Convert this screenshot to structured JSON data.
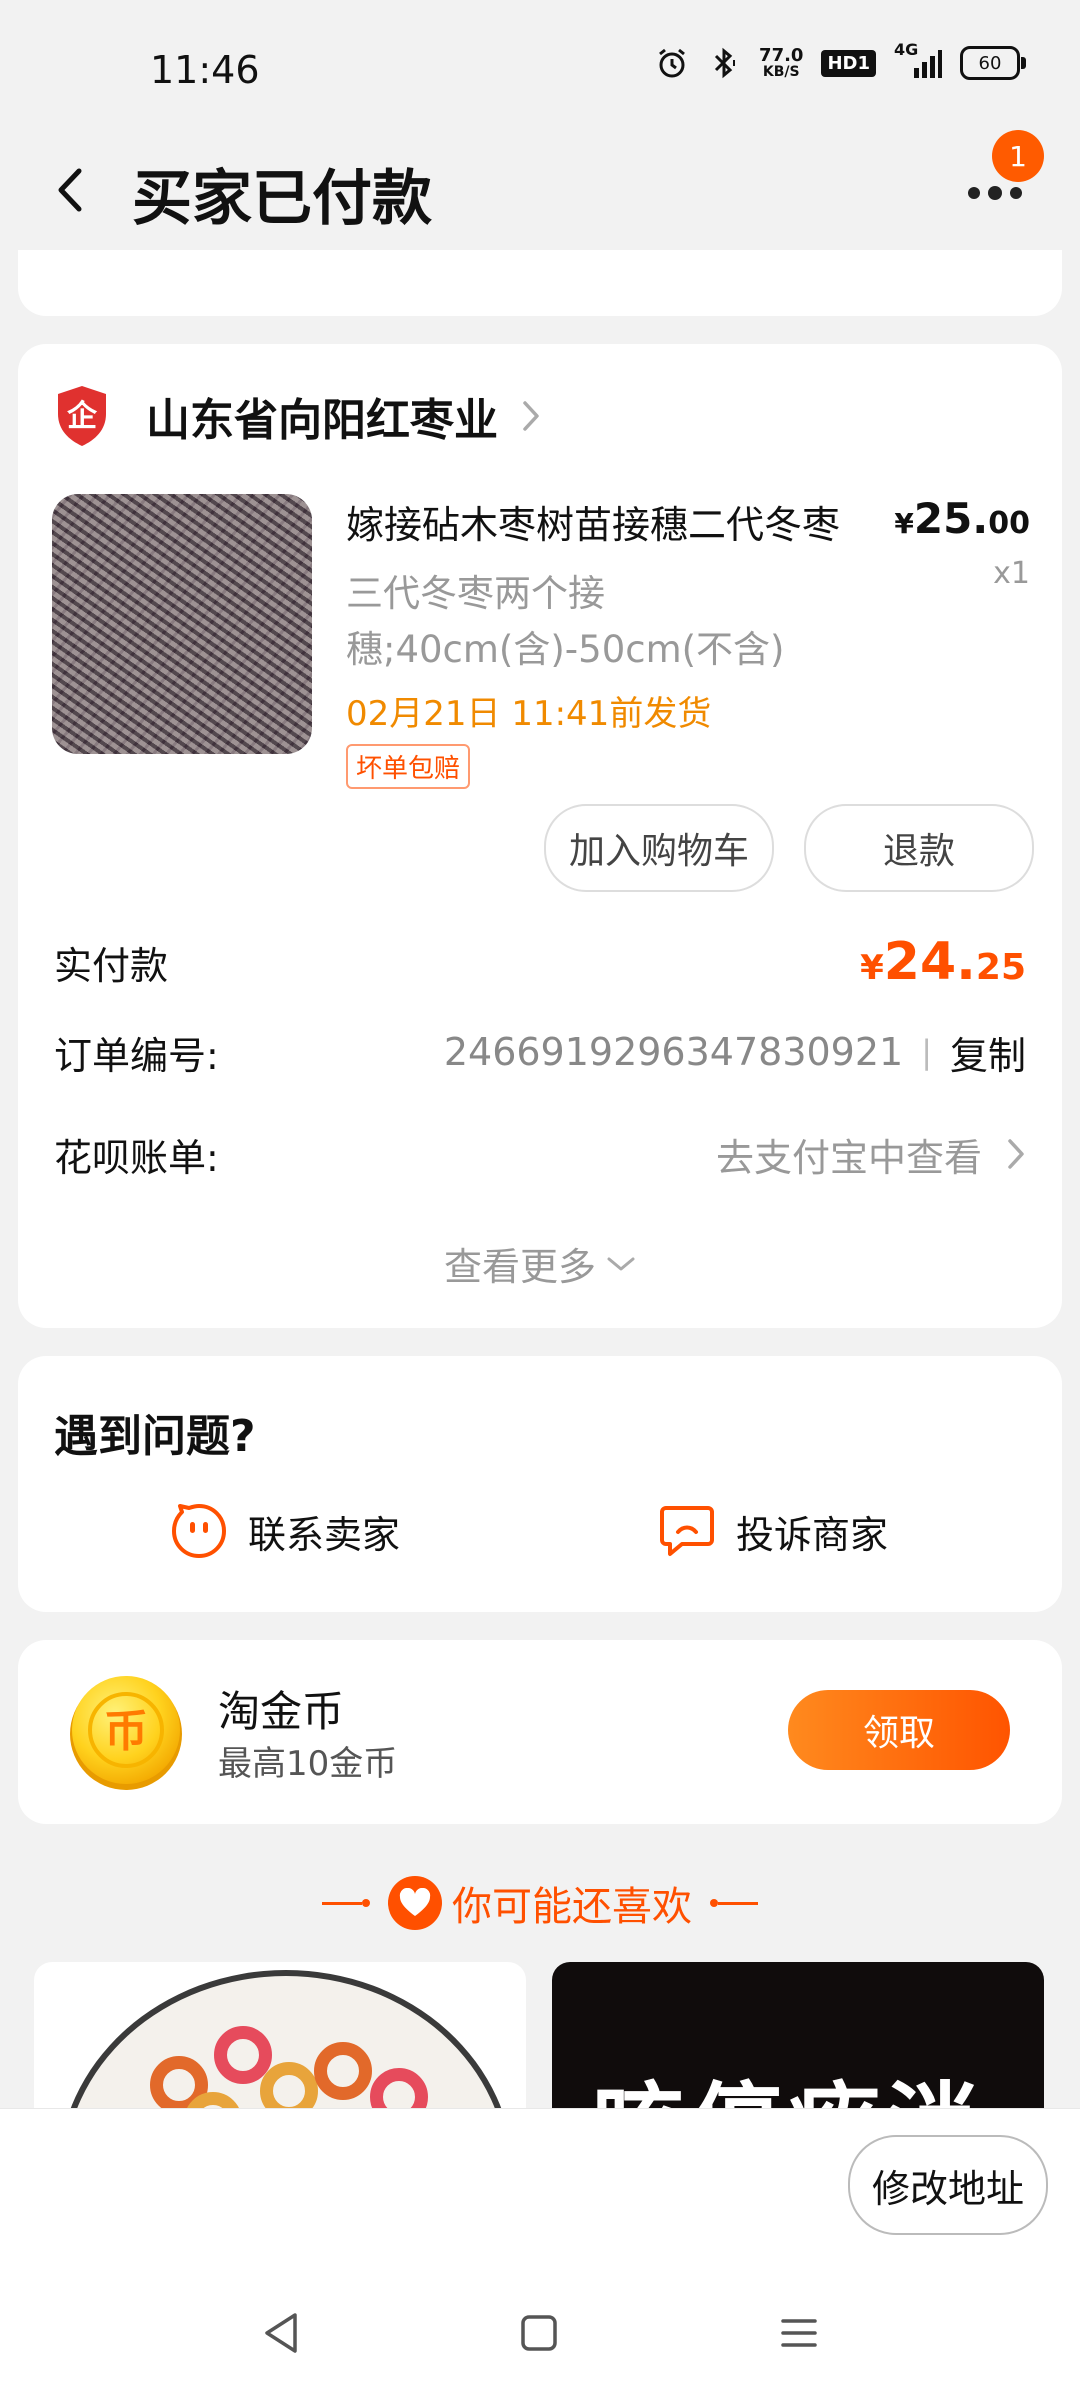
{
  "status_bar": {
    "time": "11:46",
    "network_speed_value": "77.0",
    "network_speed_unit": "KB/S",
    "hd_label": "HD1",
    "signal_type": "4G",
    "battery_level": "60"
  },
  "header": {
    "title": "买家已付款",
    "notification_count": "1"
  },
  "order": {
    "shop_badge": "企",
    "shop_name": "山东省向阳红枣业",
    "product": {
      "title": "嫁接砧木枣树苗接穗二代冬枣",
      "price_currency": "¥",
      "price_integer": "25.",
      "price_decimal": "00",
      "quantity": "x1",
      "spec": "三代冬枣两个接穗;40cm(含)-50cm(不含)",
      "ship_time": "02月21日 11:41前发货",
      "guarantee_tag": "坏单包赔"
    },
    "add_to_cart_label": "加入购物车",
    "refund_label": "退款",
    "paid_label": "实付款",
    "paid_currency": "¥",
    "paid_integer": "24.",
    "paid_decimal": "25",
    "order_number_label": "订单编号:",
    "order_number": "2466919296347830921",
    "copy_label": "复制",
    "huabei_label": "花呗账单:",
    "huabei_value": "去支付宝中查看",
    "view_more_label": "查看更多"
  },
  "problem": {
    "title": "遇到问题?",
    "contact_seller_label": "联系卖家",
    "complain_merchant_label": "投诉商家"
  },
  "coin": {
    "icon_glyph": "币",
    "title": "淘金币",
    "subtitle": "最高10金币",
    "claim_label": "领取"
  },
  "recommend": {
    "title": "你可能还喜欢",
    "tile_2_text": "咳停痰消"
  },
  "bottom": {
    "modify_address_label": "修改地址"
  },
  "colors": {
    "accent": "#ff5000",
    "ship_time": "#f08a00",
    "background": "#f2f2f2"
  }
}
